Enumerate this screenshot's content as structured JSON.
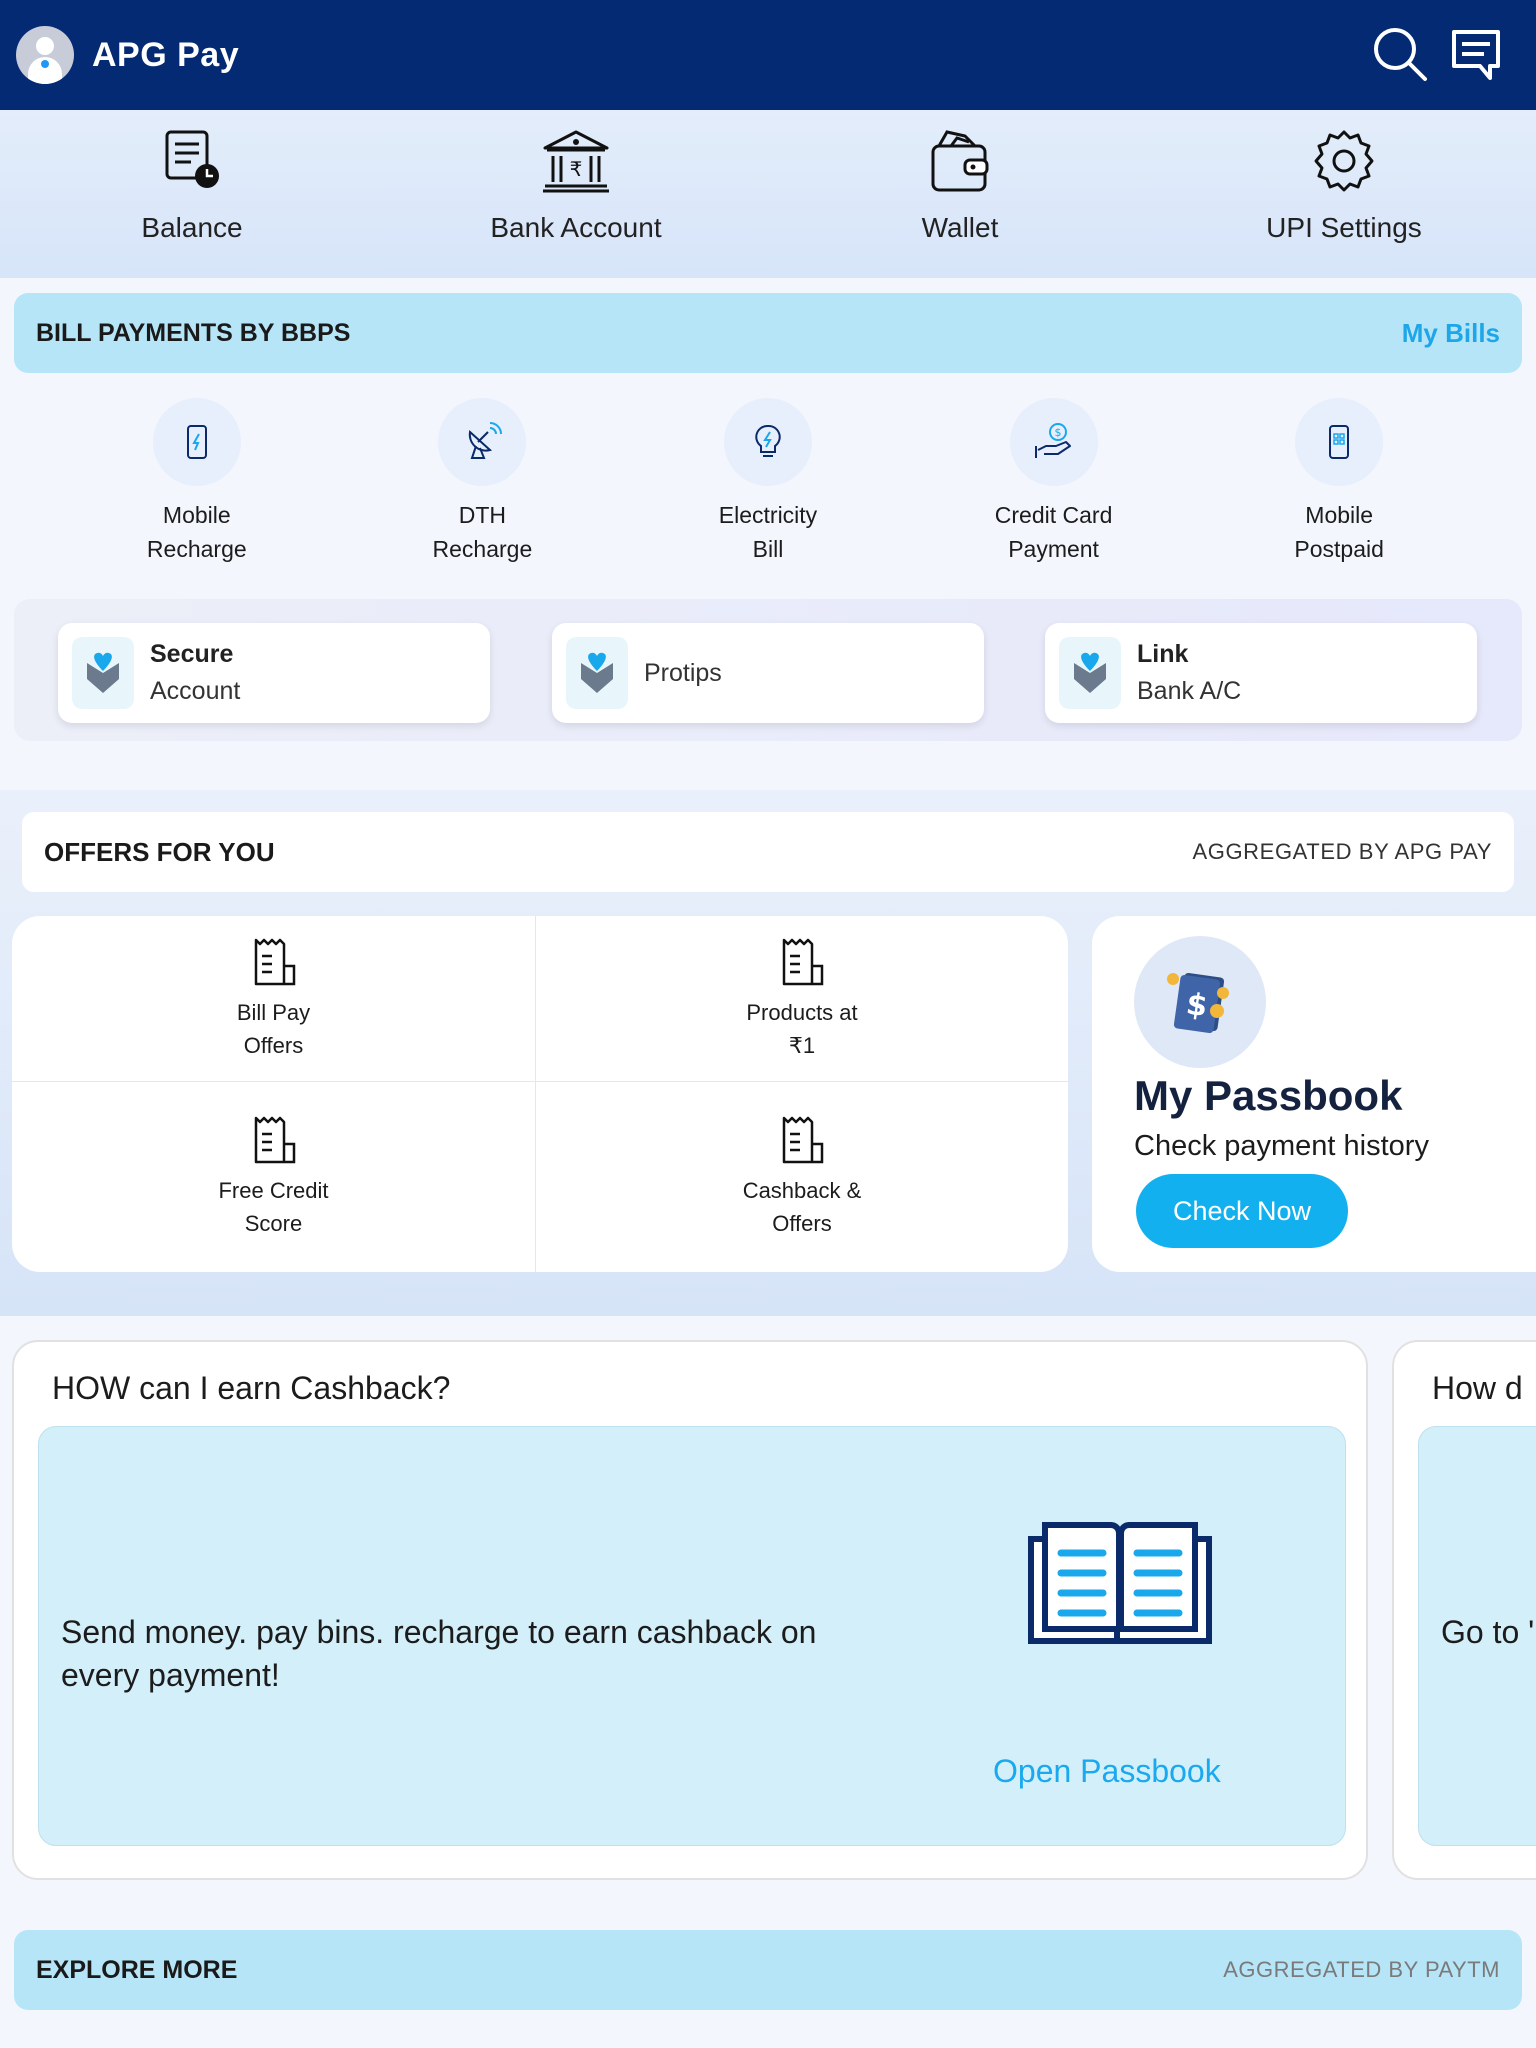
{
  "header": {
    "title": "APG Pay",
    "search_icon": "search-icon",
    "message_icon": "message-icon"
  },
  "quick_actions": [
    {
      "label": "Balance",
      "icon": "balance-icon"
    },
    {
      "label": "Bank Account",
      "icon": "bank-icon"
    },
    {
      "label": "Wallet",
      "icon": "wallet-icon"
    },
    {
      "label": "UPI Settings",
      "icon": "gear-icon"
    }
  ],
  "bbps": {
    "title": "BILL PAYMENTS BY BBPS",
    "link": "My Bills"
  },
  "bills": [
    {
      "line1": "Mobile",
      "line2": "Recharge",
      "icon": "mobile-icon"
    },
    {
      "line1": "DTH",
      "line2": "Recharge",
      "icon": "satellite-dish-icon"
    },
    {
      "line1": "Electricity",
      "line2": "Bill",
      "icon": "bulb-icon"
    },
    {
      "line1": "Credit Card",
      "line2": "Payment",
      "icon": "payment-hand-icon"
    },
    {
      "line1": "Mobile",
      "line2": "Postpaid",
      "icon": "postpaid-phone-icon"
    }
  ],
  "info_cards": [
    {
      "line1": "Secure",
      "line2": "Account"
    },
    {
      "line1": "Protips",
      "line2": ""
    },
    {
      "line1": "Link",
      "line2": "Bank A/C"
    }
  ],
  "offers": {
    "title": "OFFERS FOR YOU",
    "aggregator": "AGGREGATED BY APG PAY",
    "items": [
      {
        "line1": "Bill Pay",
        "line2": "Offers"
      },
      {
        "line1": "Products at",
        "line2": "₹1"
      },
      {
        "line1": "Free Credit",
        "line2": "Score"
      },
      {
        "line1": "Cashback &",
        "line2": "Offers"
      }
    ]
  },
  "passbook": {
    "title": "My Passbook",
    "subtitle": "Check payment history",
    "button": "Check Now"
  },
  "cashback": [
    {
      "title": "HOW can I earn Cashback?",
      "body": "Send money. pay bins. recharge to earn cashback on every payment!",
      "link": "Open Passbook"
    },
    {
      "title": "How d",
      "body": "Go to ' for an"
    }
  ],
  "explore": {
    "title": "EXPLORE MORE",
    "aggregator": "AGGREGATED BY PAYTM"
  },
  "colors": {
    "header_bg": "#032a73",
    "accent": "#12b0ef",
    "banner_bg": "#b7e5f8"
  }
}
